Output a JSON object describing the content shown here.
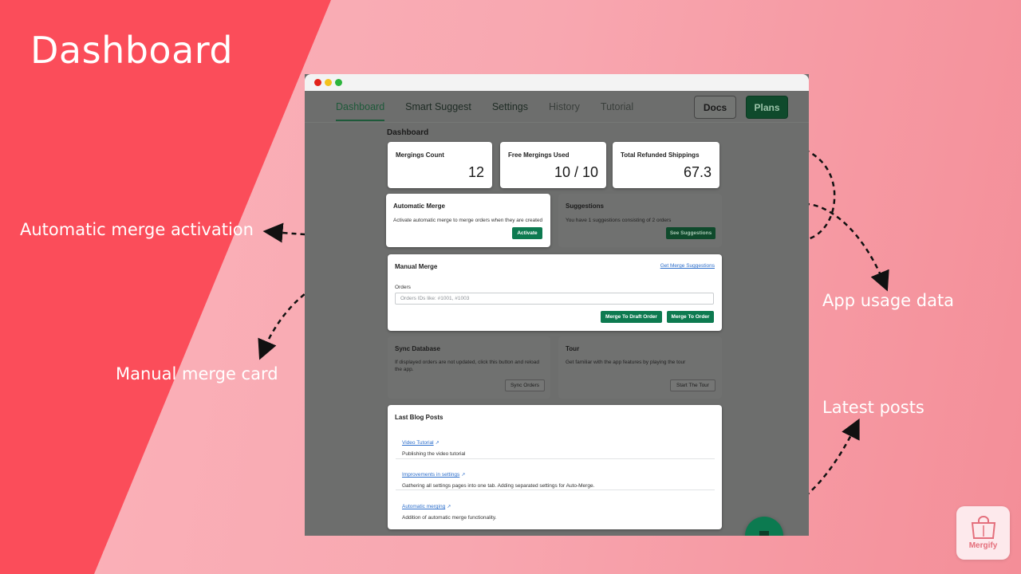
{
  "slide": {
    "title": "Dashboard",
    "callouts": {
      "auto_merge": "Automatic merge activation",
      "manual_merge": "Manual merge card",
      "usage": "App usage data",
      "posts": "Latest posts"
    }
  },
  "colors": {
    "accent": "#fb4d5a",
    "brand_green": "#0d7a50",
    "link": "#2c6ecb"
  },
  "nav": {
    "tabs": [
      "Dashboard",
      "Smart Suggest",
      "Settings",
      "History",
      "Tutorial"
    ],
    "docs_label": "Docs",
    "plans_label": "Plans"
  },
  "dashboard": {
    "heading": "Dashboard",
    "stats": [
      {
        "label": "Mergings Count",
        "value": "12"
      },
      {
        "label": "Free Mergings Used",
        "value": "10 / 10"
      },
      {
        "label": "Total Refunded Shippings",
        "value": "67.3"
      }
    ],
    "automatic_merge": {
      "title": "Automatic Merge",
      "text": "Activate automatic merge to merge orders when they are created",
      "button": "Activate"
    },
    "suggestions": {
      "title": "Suggestions",
      "text": "You have 1 suggestions consisting of 2 orders",
      "button": "See Suggestions"
    },
    "manual_merge": {
      "title": "Manual Merge",
      "link": "Get Merge Suggestions",
      "orders_label": "Orders",
      "orders_placeholder": "Orders IDs like: #1001, #1003",
      "draft_button": "Merge To Draft Order",
      "order_button": "Merge To Order"
    },
    "sync_database": {
      "title": "Sync Database",
      "text": "If displayed orders are not updated, click this button and reload the app.",
      "button": "Sync Orders"
    },
    "tour": {
      "title": "Tour",
      "text": "Get familiar with the app features by playing the tour",
      "button": "Start The Tour"
    },
    "blog": {
      "title": "Last Blog Posts",
      "posts": [
        {
          "title": "Video Tutorial",
          "desc": "Publishing the video tutorial"
        },
        {
          "title": "Improvements in settings",
          "desc": "Gathering all settings pages into one tab. Adding separated settings for Auto-Merge."
        },
        {
          "title": "Automatic merging",
          "desc": "Addition of automatic merge functionality."
        }
      ]
    }
  },
  "logo": {
    "text": "Mergify"
  },
  "icons": [
    "external-link-icon",
    "chat-icon",
    "shopping-bag-icon"
  ]
}
